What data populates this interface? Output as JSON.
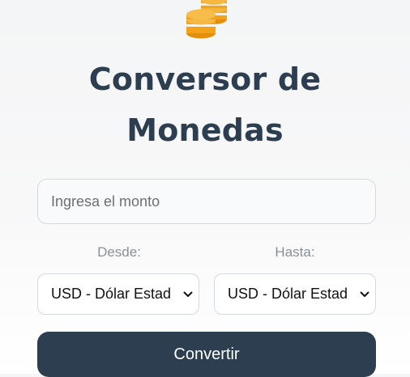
{
  "header": {
    "icon": "coins-icon",
    "title_line1": "Conversor de",
    "title_line2": "Monedas"
  },
  "form": {
    "amount": {
      "placeholder": "Ingresa el monto",
      "value": ""
    },
    "from": {
      "label": "Desde:",
      "selected": "USD - Dólar Estad"
    },
    "to": {
      "label": "Hasta:",
      "selected": "USD - Dólar Estad"
    },
    "convert_label": "Convertir"
  },
  "colors": {
    "accent": "#f3a21b",
    "primary": "#2c3e50",
    "label": "#8a8f96"
  }
}
